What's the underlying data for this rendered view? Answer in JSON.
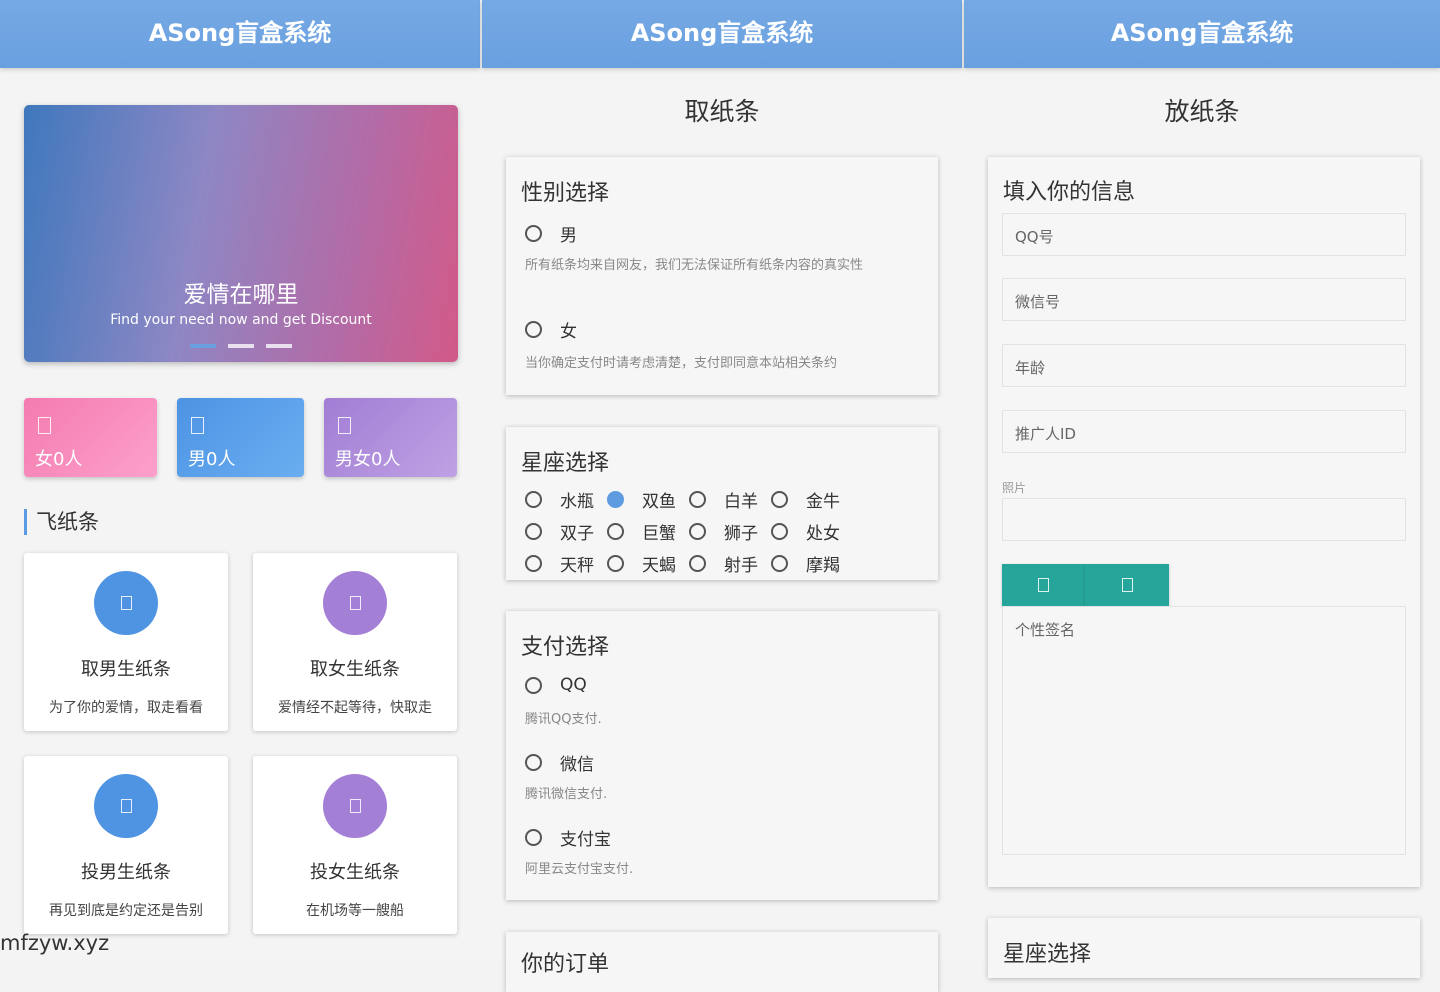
{
  "app_title": "ASong盲盒系统",
  "home": {
    "banner": {
      "title": "爱情在哪里",
      "subtitle": "Find your need now and get Discount",
      "slide_count": 3,
      "active_slide": 1
    },
    "stats": [
      {
        "label": "女0人",
        "color": "#f48fbf"
      },
      {
        "label": "男0人",
        "color": "#5a9fe6"
      },
      {
        "label": "男女0人",
        "color": "#a98ad6"
      }
    ],
    "section_title": "飞纸条",
    "cards": [
      {
        "title": "取男生纸条",
        "subtitle": "为了你的爱情，取走看看",
        "color": "#4f94e3"
      },
      {
        "title": "取女生纸条",
        "subtitle": "爱情经不起等待，快取走",
        "color": "#a47fd6"
      },
      {
        "title": "投男生纸条",
        "subtitle": "再见到底是约定还是告别",
        "color": "#4f94e3"
      },
      {
        "title": "投女生纸条",
        "subtitle": "在机场等一艘船",
        "color": "#a47fd6"
      }
    ]
  },
  "take": {
    "title": "取纸条",
    "gender": {
      "title": "性别选择",
      "options": [
        {
          "label": "男",
          "hint": "所有纸条均来自网友，我们无法保证所有纸条内容的真实性"
        },
        {
          "label": "女",
          "hint": "当你确定支付时请考虑清楚，支付即同意本站相关条约"
        }
      ]
    },
    "zodiac": {
      "title": "星座选择",
      "options": [
        "水瓶",
        "双鱼",
        "白羊",
        "金牛",
        "双子",
        "巨蟹",
        "狮子",
        "处女",
        "天秤",
        "天蝎",
        "射手",
        "摩羯"
      ],
      "selected": "双鱼"
    },
    "payment": {
      "title": "支付选择",
      "options": [
        {
          "label": "QQ",
          "hint": "腾讯QQ支付."
        },
        {
          "label": "微信",
          "hint": "腾讯微信支付."
        },
        {
          "label": "支付宝",
          "hint": "阿里云支付宝支付."
        }
      ]
    },
    "order_title": "你的订单"
  },
  "put": {
    "title": "放纸条",
    "form_title": "填入你的信息",
    "placeholders": {
      "qq": "QQ号",
      "wechat": "微信号",
      "age": "年龄",
      "promoter": "推广人ID",
      "signature": "个性签名"
    },
    "photo_label": "照片",
    "zodiac_title": "星座选择"
  },
  "watermark": "mfzyw.xyz"
}
